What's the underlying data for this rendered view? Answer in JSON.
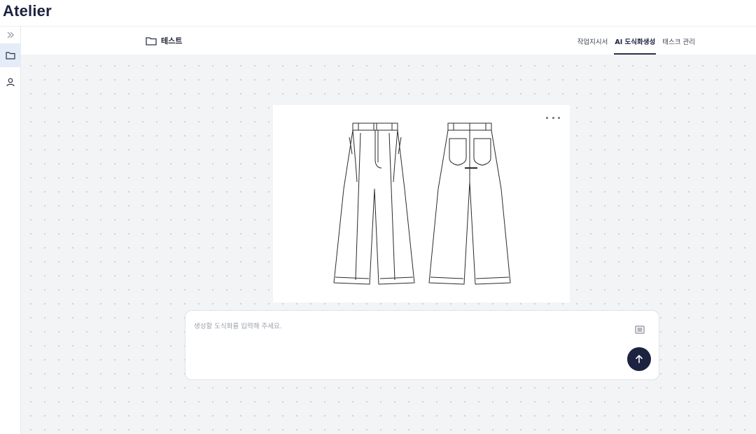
{
  "app": {
    "title": "Atelier"
  },
  "sidebar": {
    "items": [
      {
        "name": "expand",
        "icon": "double-chevron-right-icon"
      },
      {
        "name": "projects",
        "icon": "folder-icon",
        "active": true
      },
      {
        "name": "profile",
        "icon": "user-icon"
      }
    ]
  },
  "header": {
    "project_name": "테스트",
    "tabs": [
      {
        "label": "작업지시서",
        "active": false
      },
      {
        "label": "AI 도식화생성",
        "active": true
      },
      {
        "label": "태스크 관리",
        "active": false
      }
    ]
  },
  "canvas": {
    "image_alt": "Technical flat sketch of wide-leg trousers, front and back view",
    "more_icon": "more-horizontal-icon"
  },
  "prompt": {
    "placeholder": "생성할 도식화를 입력해 주세요.",
    "value": "",
    "attach_icon": "document-icon",
    "send_icon": "arrow-up-icon"
  },
  "colors": {
    "brand": "#1c2340",
    "accent": "#1c2340",
    "canvas_bg": "#f3f4f6",
    "active_sidebar": "#e4ecf8"
  }
}
